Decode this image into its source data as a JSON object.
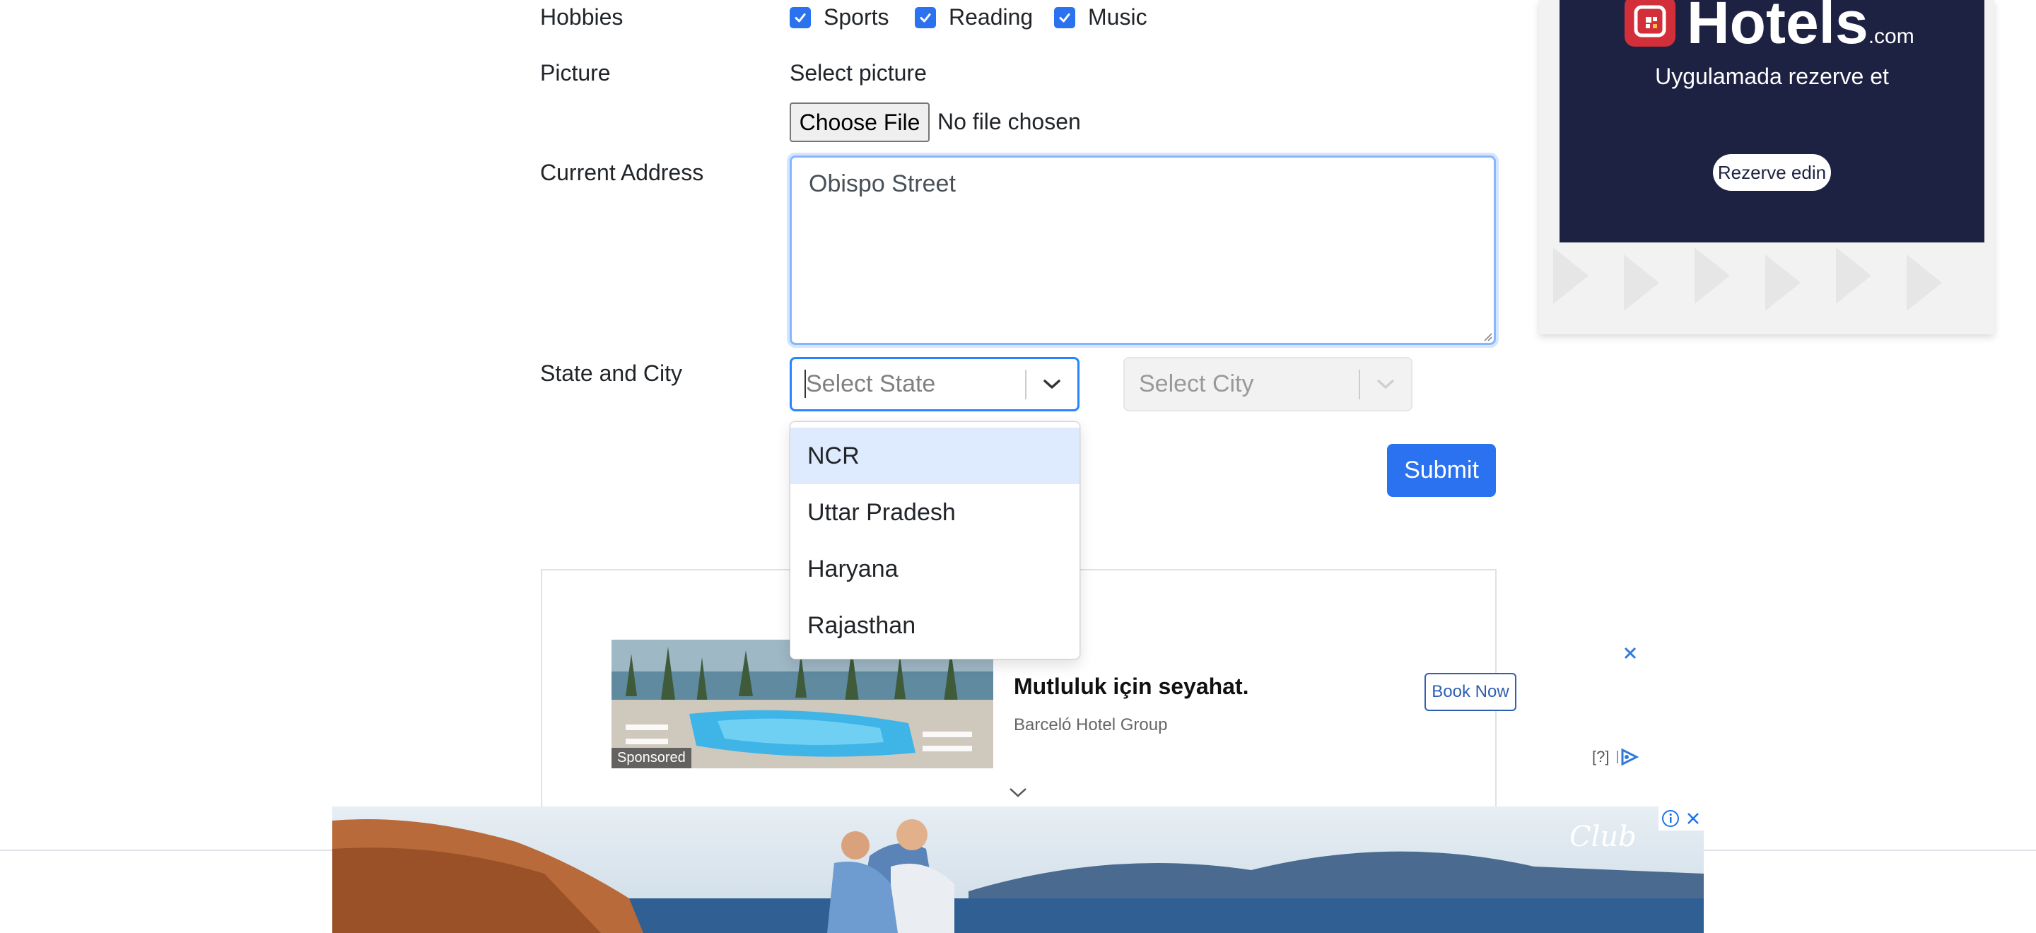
{
  "form": {
    "hobbies_label": "Hobbies",
    "hobbies": [
      {
        "label": "Sports",
        "checked": true
      },
      {
        "label": "Reading",
        "checked": true
      },
      {
        "label": "Music",
        "checked": true
      }
    ],
    "picture_label": "Picture",
    "picture_hint": "Select picture",
    "file_button": "Choose File",
    "file_status": "No file chosen",
    "address_label": "Current Address",
    "address_value": "Obispo Street",
    "state_city_label": "State and City",
    "state_placeholder": "Select State",
    "city_placeholder": "Select City",
    "state_options": [
      "NCR",
      "Uttar Pradesh",
      "Haryana",
      "Rajasthan"
    ],
    "highlighted_option": "NCR",
    "submit_label": "Submit"
  },
  "ads": {
    "hotels": {
      "brand": "Hotels",
      "brand_suffix": ".com",
      "tagline": "Uygulamada rezerve et",
      "cta": "Rezerve edin"
    },
    "sponsored": {
      "badge": "Sponsored",
      "headline": "Mutluluk için seyahat.",
      "advertiser": "Barceló Hotel Group",
      "cta": "Book Now",
      "help": "[?]"
    },
    "banner": {
      "brand": "Club"
    }
  },
  "colors": {
    "primary": "#2b72f0",
    "focus_border": "#2684ff",
    "option_highlight": "#deebff",
    "hotels_bg": "#1e2242",
    "hotels_red": "#d32f3a"
  }
}
